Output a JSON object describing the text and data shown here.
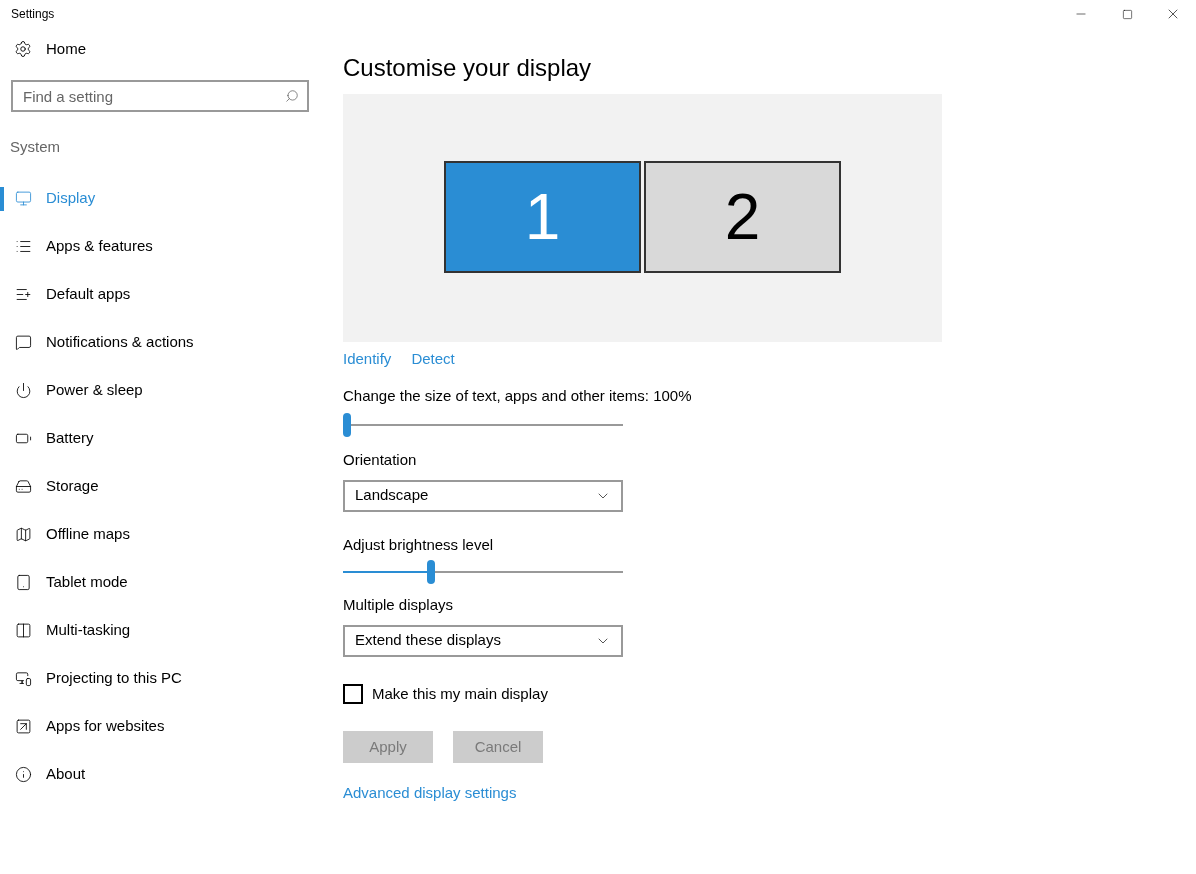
{
  "window": {
    "title": "Settings"
  },
  "sidebar": {
    "home": "Home",
    "search": {
      "placeholder": "Find a setting"
    },
    "section": "System",
    "items": [
      {
        "label": "Display",
        "selected": true
      },
      {
        "label": "Apps & features",
        "selected": false
      },
      {
        "label": "Default apps",
        "selected": false
      },
      {
        "label": "Notifications & actions",
        "selected": false
      },
      {
        "label": "Power & sleep",
        "selected": false
      },
      {
        "label": "Battery",
        "selected": false
      },
      {
        "label": "Storage",
        "selected": false
      },
      {
        "label": "Offline maps",
        "selected": false
      },
      {
        "label": "Tablet mode",
        "selected": false
      },
      {
        "label": "Multi-tasking",
        "selected": false
      },
      {
        "label": "Projecting to this PC",
        "selected": false
      },
      {
        "label": "Apps for websites",
        "selected": false
      },
      {
        "label": "About",
        "selected": false
      }
    ]
  },
  "main": {
    "title": "Customise your display",
    "displays": [
      {
        "label": "1",
        "selected": true
      },
      {
        "label": "2",
        "selected": false
      }
    ],
    "links": [
      "Identify",
      "Detect"
    ],
    "scale": {
      "label": "Change the size of text, apps and other items: 100%",
      "level": 0
    },
    "orientation": {
      "label": "Orientation",
      "value": "Landscape"
    },
    "brightness": {
      "label": "Adjust brightness level",
      "level": 0.31
    },
    "multiple_displays": {
      "label": "Multiple displays",
      "value": "Extend these displays"
    },
    "main_display": {
      "label": "Make this my main display",
      "checked": false
    },
    "buttons": [
      {
        "label": "Apply",
        "disabled": true
      },
      {
        "label": "Cancel",
        "disabled": true
      }
    ],
    "advanced_link": "Advanced display settings"
  }
}
